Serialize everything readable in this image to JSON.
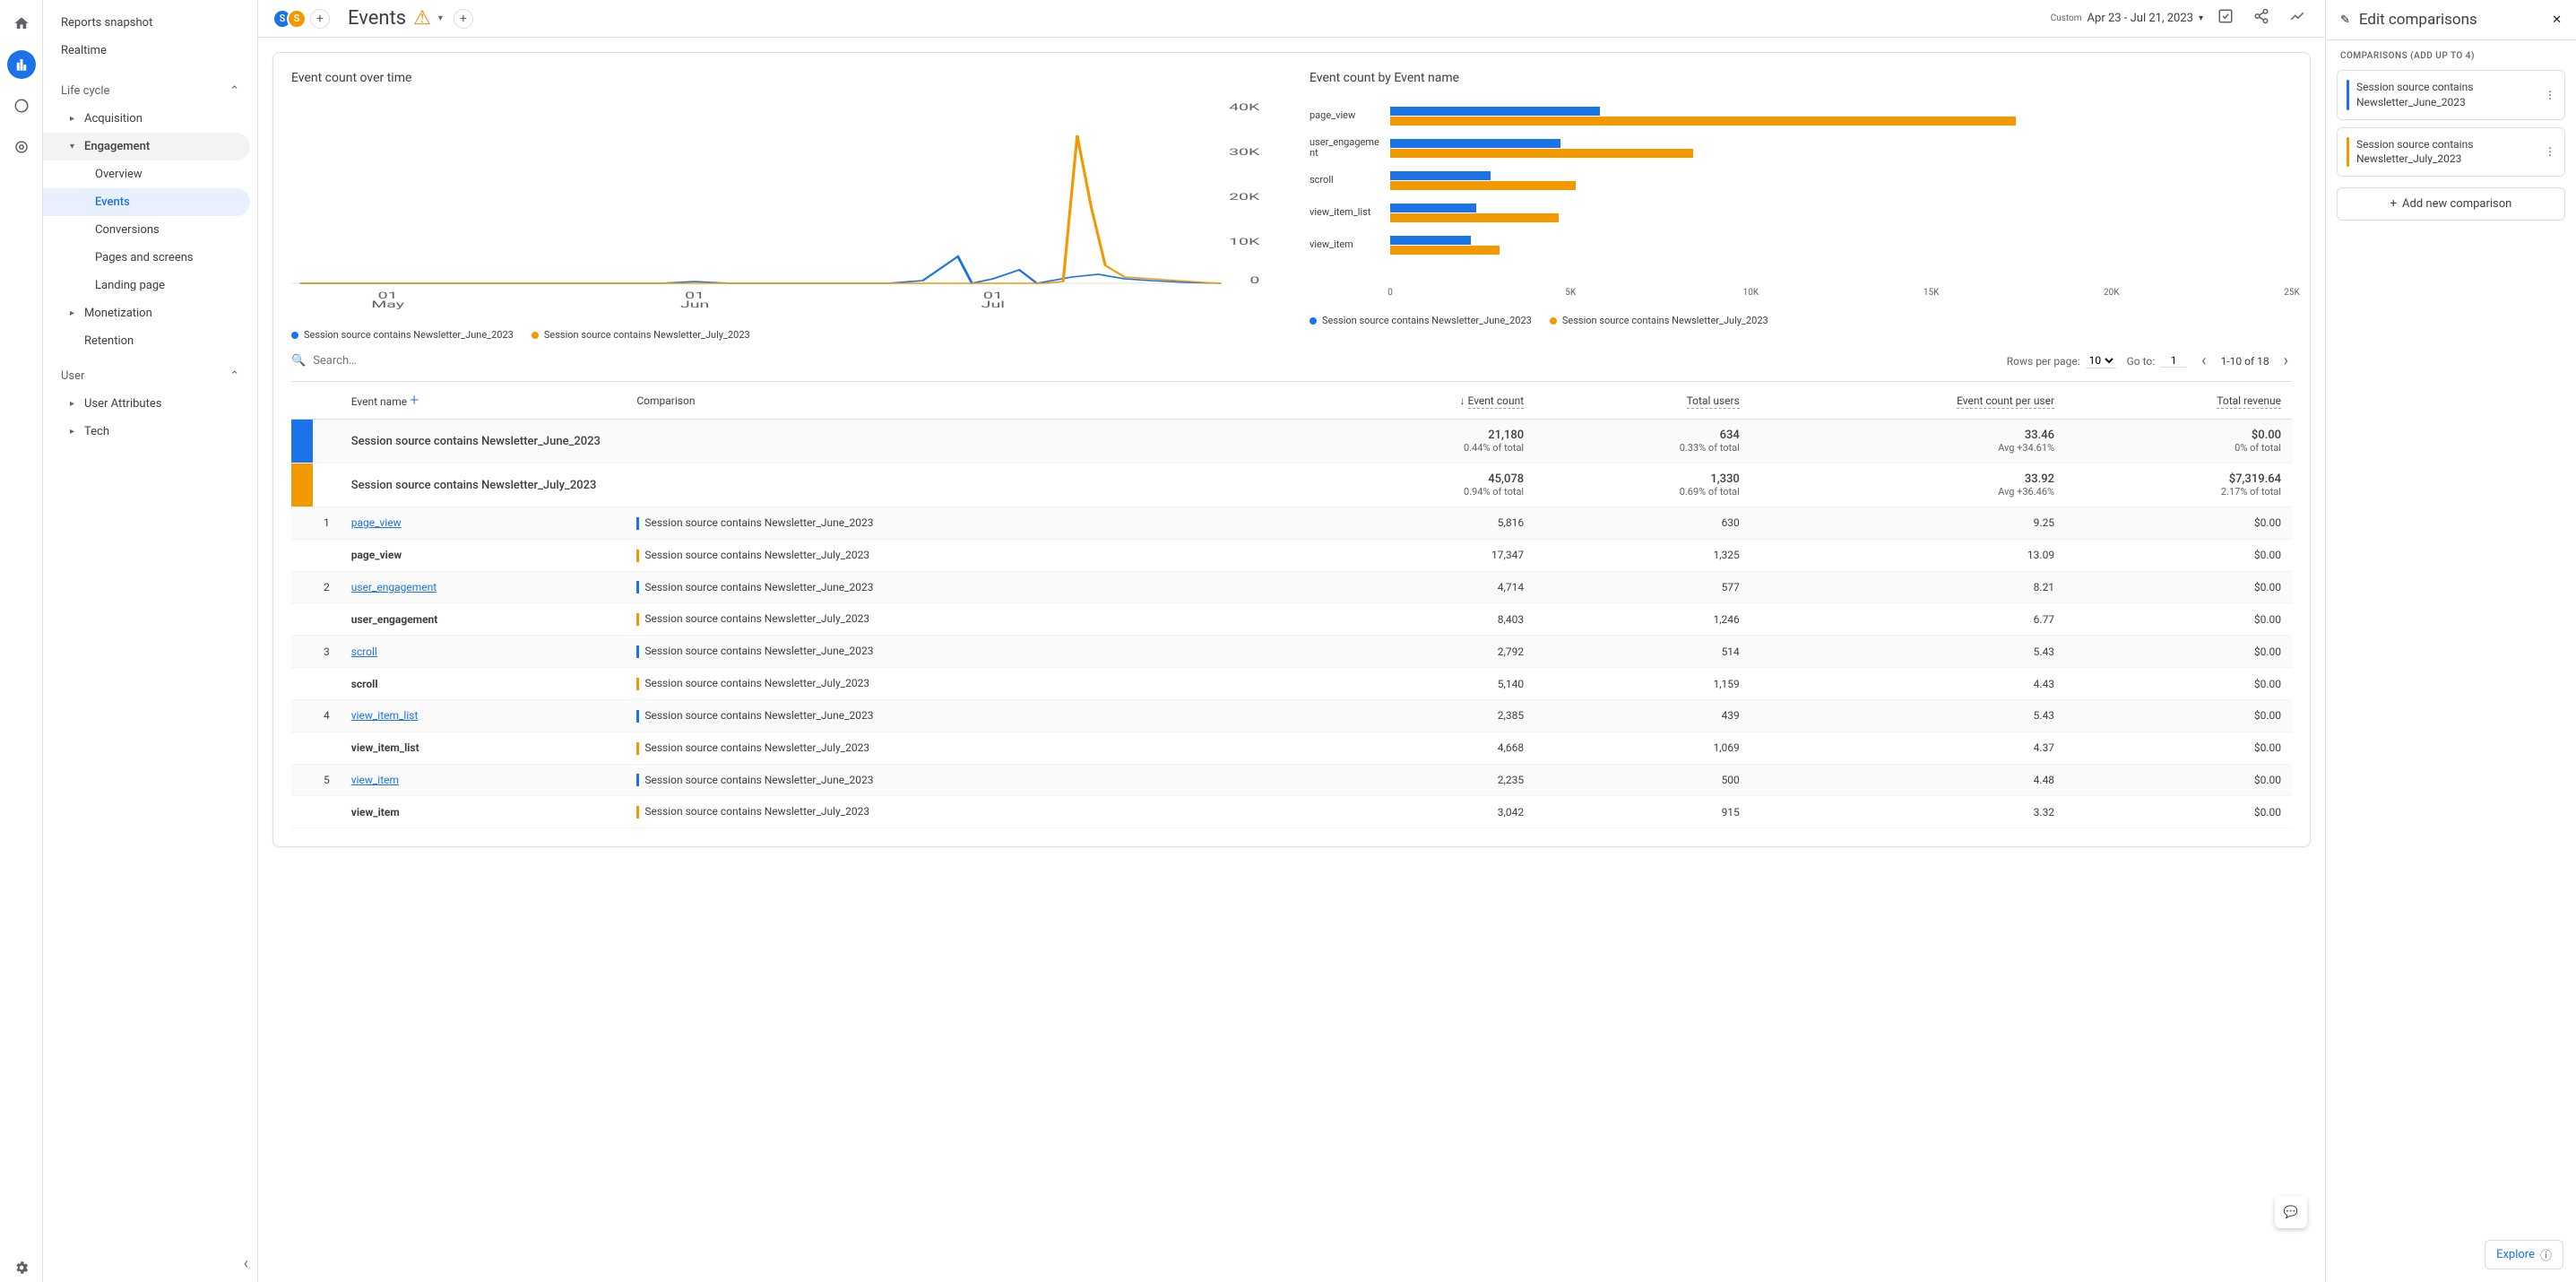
{
  "rail": {
    "home": "home",
    "reports": "reports",
    "explore": "explore",
    "ads": "ads",
    "admin": "admin"
  },
  "sidebar": {
    "reports_snapshot": "Reports snapshot",
    "realtime": "Realtime",
    "life_cycle": "Life cycle",
    "acquisition": "Acquisition",
    "engagement": "Engagement",
    "eng_items": {
      "overview": "Overview",
      "events": "Events",
      "conversions": "Conversions",
      "pages": "Pages and screens",
      "landing": "Landing page"
    },
    "monetization": "Monetization",
    "retention": "Retention",
    "user": "User",
    "user_attrs": "User Attributes",
    "tech": "Tech"
  },
  "topbar": {
    "chip1": "S",
    "chip2": "S",
    "title": "Events",
    "custom": "Custom",
    "date_range": "Apr 23 - Jul 21, 2023"
  },
  "chart_data": [
    {
      "type": "line",
      "title": "Event count over time",
      "ylim": [
        0,
        40000
      ],
      "yticks": [
        "0",
        "10K",
        "20K",
        "30K",
        "40K"
      ],
      "xticks": [
        "01 May",
        "01 Jun",
        "01 Jul"
      ],
      "series": [
        {
          "name": "Session source contains Newsletter_June_2023",
          "color": "#1a73e8"
        },
        {
          "name": "Session source contains Newsletter_July_2023",
          "color": "#f29900"
        }
      ]
    },
    {
      "type": "bar",
      "title": "Event count by Event name",
      "xlim": [
        0,
        25000
      ],
      "xticks": [
        "0",
        "5K",
        "10K",
        "15K",
        "20K",
        "25K"
      ],
      "categories": [
        "page_view",
        "user_engagement",
        "scroll",
        "view_item_list",
        "view_item"
      ],
      "series": [
        {
          "name": "Session source contains Newsletter_June_2023",
          "color": "#1a73e8",
          "values": [
            5816,
            4714,
            2792,
            2385,
            2235
          ]
        },
        {
          "name": "Session source contains Newsletter_July_2023",
          "color": "#f29900",
          "values": [
            17347,
            8403,
            5140,
            4668,
            3042
          ]
        }
      ]
    }
  ],
  "legend": {
    "a": "Session source contains Newsletter_June_2023",
    "b": "Session source contains Newsletter_July_2023"
  },
  "controls": {
    "search_placeholder": "Search…",
    "rows_label": "Rows per page:",
    "rows_value": "10",
    "goto_label": "Go to:",
    "goto_value": "1",
    "page_info": "1-10 of 18"
  },
  "table": {
    "headers": {
      "event": "Event name",
      "comparison": "Comparison",
      "event_count": "Event count",
      "total_users": "Total users",
      "ecpu": "Event count per user",
      "revenue": "Total revenue"
    },
    "summary": [
      {
        "comp": "Session source contains Newsletter_June_2023",
        "ec": "21,180",
        "ec_sub": "0.44% of total",
        "tu": "634",
        "tu_sub": "0.33% of total",
        "ecpu": "33.46",
        "ecpu_sub": "Avg +34.61%",
        "rev": "$0.00",
        "rev_sub": "0% of total",
        "color": "blue"
      },
      {
        "comp": "Session source contains Newsletter_July_2023",
        "ec": "45,078",
        "ec_sub": "0.94% of total",
        "tu": "1,330",
        "tu_sub": "0.69% of total",
        "ecpu": "33.92",
        "ecpu_sub": "Avg +36.46%",
        "rev": "$7,319.64",
        "rev_sub": "2.17% of total",
        "color": "orange"
      }
    ],
    "rows": [
      {
        "n": "1",
        "event": "page_view",
        "link": true,
        "comp": "Session source contains Newsletter_June_2023",
        "ec": "5,816",
        "tu": "630",
        "ecpu": "9.25",
        "rev": "$0.00",
        "color": "blue"
      },
      {
        "n": "",
        "event": "page_view",
        "link": false,
        "comp": "Session source contains Newsletter_July_2023",
        "ec": "17,347",
        "tu": "1,325",
        "ecpu": "13.09",
        "rev": "$0.00",
        "color": "orange"
      },
      {
        "n": "2",
        "event": "user_engagement",
        "link": true,
        "comp": "Session source contains Newsletter_June_2023",
        "ec": "4,714",
        "tu": "577",
        "ecpu": "8.21",
        "rev": "$0.00",
        "color": "blue"
      },
      {
        "n": "",
        "event": "user_engagement",
        "link": false,
        "comp": "Session source contains Newsletter_July_2023",
        "ec": "8,403",
        "tu": "1,246",
        "ecpu": "6.77",
        "rev": "$0.00",
        "color": "orange"
      },
      {
        "n": "3",
        "event": "scroll",
        "link": true,
        "comp": "Session source contains Newsletter_June_2023",
        "ec": "2,792",
        "tu": "514",
        "ecpu": "5.43",
        "rev": "$0.00",
        "color": "blue"
      },
      {
        "n": "",
        "event": "scroll",
        "link": false,
        "comp": "Session source contains Newsletter_July_2023",
        "ec": "5,140",
        "tu": "1,159",
        "ecpu": "4.43",
        "rev": "$0.00",
        "color": "orange"
      },
      {
        "n": "4",
        "event": "view_item_list",
        "link": true,
        "comp": "Session source contains Newsletter_June_2023",
        "ec": "2,385",
        "tu": "439",
        "ecpu": "5.43",
        "rev": "$0.00",
        "color": "blue"
      },
      {
        "n": "",
        "event": "view_item_list",
        "link": false,
        "comp": "Session source contains Newsletter_July_2023",
        "ec": "4,668",
        "tu": "1,069",
        "ecpu": "4.37",
        "rev": "$0.00",
        "color": "orange"
      },
      {
        "n": "5",
        "event": "view_item",
        "link": true,
        "comp": "Session source contains Newsletter_June_2023",
        "ec": "2,235",
        "tu": "500",
        "ecpu": "4.48",
        "rev": "$0.00",
        "color": "blue"
      },
      {
        "n": "",
        "event": "view_item",
        "link": false,
        "comp": "Session source contains Newsletter_July_2023",
        "ec": "3,042",
        "tu": "915",
        "ecpu": "3.32",
        "rev": "$0.00",
        "color": "orange"
      }
    ]
  },
  "right": {
    "title": "Edit comparisons",
    "sub": "COMPARISONS (ADD UP TO 4)",
    "c1": "Session source contains Newsletter_June_2023",
    "c2": "Session source contains Newsletter_July_2023",
    "add": "Add new comparison"
  },
  "explore": "Explore"
}
